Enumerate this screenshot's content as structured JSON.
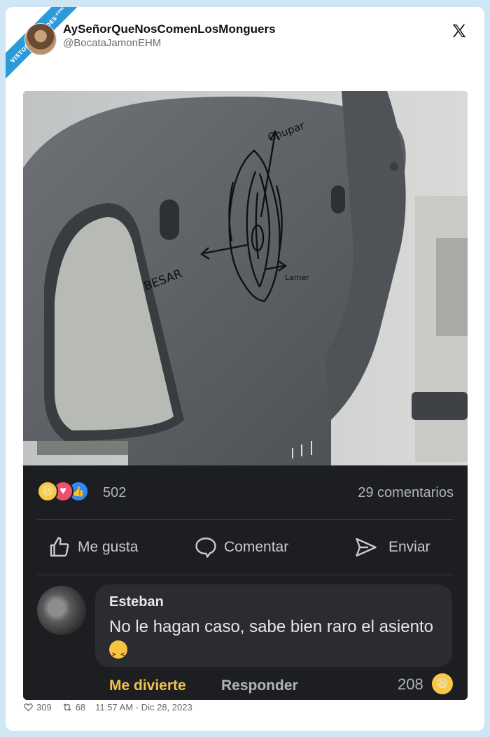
{
  "watermark": {
    "text": "VISTOENLASREDES",
    "suffix": ".com"
  },
  "tweet": {
    "display_name": "AySeñorQueNosComenLosMonguers",
    "handle": "@BocataJamonEHM",
    "likes": "309",
    "retweets": "68",
    "timestamp": "11:57 AM - Dic 28, 2023"
  },
  "photo": {
    "labels": {
      "top": "Chupar",
      "left": "BESAR",
      "right": "Lamer"
    }
  },
  "facebook": {
    "reaction_count": "502",
    "comments_count": "29 comentarios",
    "actions": {
      "like": "Me gusta",
      "comment": "Comentar",
      "send": "Enviar"
    },
    "comment": {
      "author": "Esteban",
      "text": "No le hagan caso, sabe bien raro el asiento",
      "reaction_label": "Me divierte",
      "reply_label": "Responder",
      "reaction_count": "208"
    }
  },
  "colors": {
    "background": "#cfe6f5",
    "ribbon": "#2a9ad8",
    "fb_dark": "#1d1e22",
    "haha_yellow": "#f2c14e"
  }
}
